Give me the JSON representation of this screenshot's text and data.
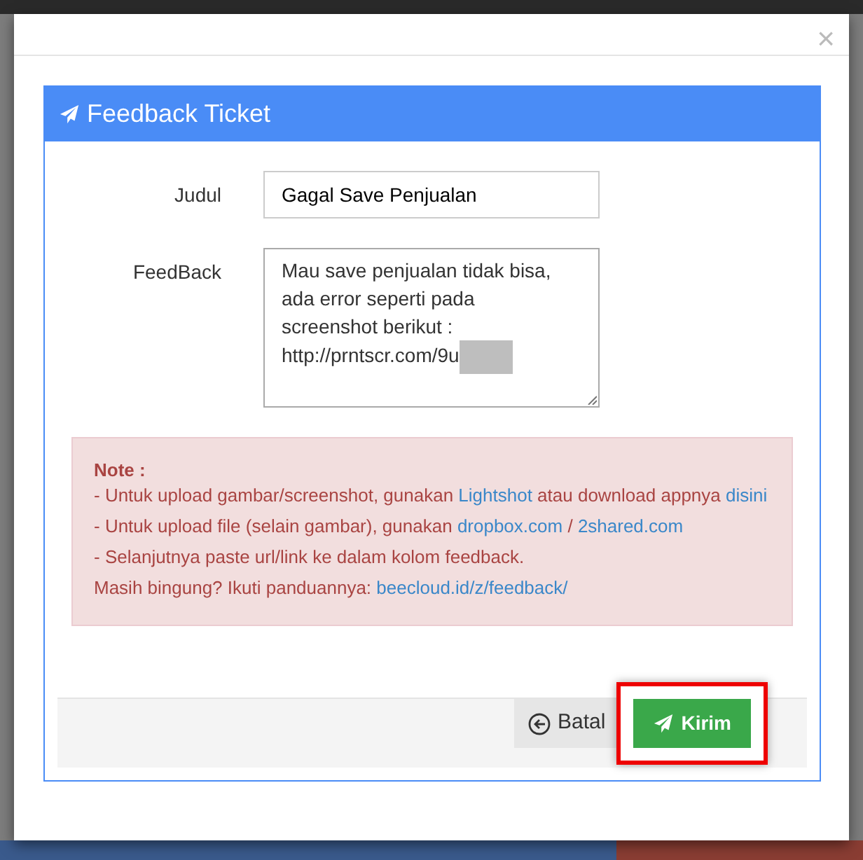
{
  "modal": {
    "close": "×",
    "panel": {
      "title": "Feedback Ticket",
      "fields": [
        {
          "kind": "input",
          "label": "Judul",
          "value": "Gagal Save Penjualan"
        },
        {
          "kind": "textarea",
          "label": "FeedBack",
          "value": "Mau save penjualan tidak bisa, ada error seperti pada screenshot berikut : http://prntscr.com/9u",
          "redacted": true
        }
      ],
      "note": {
        "heading": "Note :",
        "lines": [
          [
            {
              "text": "- Untuk upload gambar/screenshot, gunakan "
            },
            {
              "text": "Lightshot",
              "link": true
            },
            {
              "text": " atau download appnya "
            },
            {
              "text": "disini",
              "link": true
            }
          ],
          [
            {
              "text": "- Untuk upload file (selain gambar), gunakan "
            },
            {
              "text": "dropbox.com",
              "link": true
            },
            {
              "text": " / "
            },
            {
              "text": "2shared.com",
              "link": true
            }
          ],
          [
            {
              "text": "- Selanjutnya paste url/link ke dalam kolom feedback."
            }
          ],
          [
            {
              "text": "Masih bingung? Ikuti panduannya: "
            },
            {
              "text": "beecloud.id/z/feedback/",
              "link": true
            }
          ]
        ]
      },
      "buttons": [
        {
          "kind": "cancel",
          "label": "Batal",
          "highlighted": false
        },
        {
          "kind": "submit",
          "label": "Kirim",
          "highlighted": true
        }
      ]
    }
  }
}
